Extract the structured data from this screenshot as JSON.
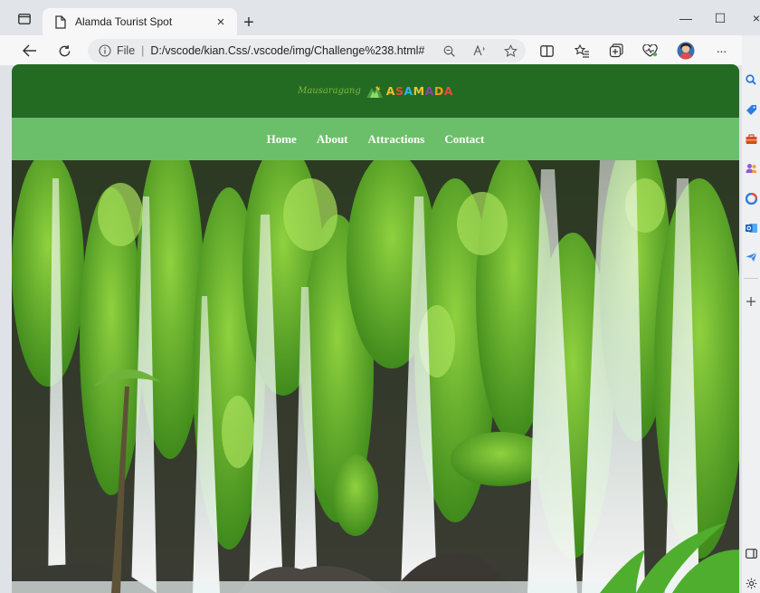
{
  "browser": {
    "tab": {
      "title": "Alamda Tourist Spot",
      "close_glyph": "×"
    },
    "new_tab_glyph": "+",
    "window_controls": {
      "minimize": "—",
      "maximize": "☐",
      "close": "×"
    },
    "address": {
      "protocol": "File",
      "separator": "|",
      "url": "D:/vscode/kian.Css/.vscode/img/Challenge%238.html#"
    },
    "toolbar_icons": [
      "back-icon",
      "refresh-icon",
      "zoom-icon",
      "read-aloud-icon",
      "favorite-star-icon",
      "split-screen-icon",
      "favorites-icon",
      "collections-icon",
      "performance-icon",
      "profile-avatar",
      "more-icon",
      "copilot-icon"
    ],
    "more_glyph": "···"
  },
  "site": {
    "logo_script": "Mausaragang",
    "logo_letters": [
      "A",
      "S",
      "A",
      "M",
      "A",
      "D",
      "A"
    ],
    "nav": [
      {
        "label": "Home"
      },
      {
        "label": "About"
      },
      {
        "label": "Attractions"
      },
      {
        "label": "Contact"
      }
    ],
    "colors": {
      "header_bg": "#236a23",
      "nav_bg": "#6cbf6a",
      "nav_text": "#ffffff"
    }
  },
  "sidebar": {
    "icons": [
      "search-icon",
      "shopping-tag-icon",
      "toolbox-icon",
      "people-icon",
      "office-icon",
      "outlook-icon",
      "send-icon",
      "add-icon",
      "sidebar-toggle-icon",
      "settings-icon"
    ]
  }
}
